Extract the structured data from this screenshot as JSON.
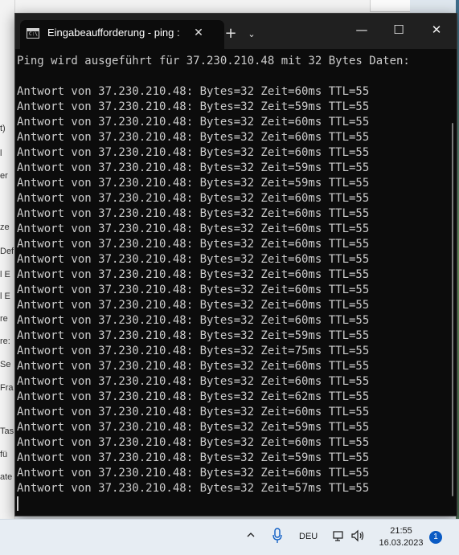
{
  "background_window": {
    "labels": [
      "t)",
      "l",
      "er",
      "ze",
      "Def",
      "l E",
      "l E",
      "re",
      "re:",
      "Se",
      "Fra",
      "Tas",
      "fü",
      "ate"
    ]
  },
  "terminal": {
    "tab_title": "Eingabeaufforderung - ping :",
    "tab_icon_glyph": "C:\\",
    "new_tab_label": "+",
    "dropdown_label": "⌄",
    "minimize_label": "—",
    "maximize_label": "☐",
    "close_label": "✕",
    "tab_close_label": "✕",
    "lines": [
      "Ping wird ausgeführt für 37.230.210.48 mit 32 Bytes Daten:",
      "",
      "Antwort von 37.230.210.48: Bytes=32 Zeit=60ms TTL=55",
      "Antwort von 37.230.210.48: Bytes=32 Zeit=59ms TTL=55",
      "Antwort von 37.230.210.48: Bytes=32 Zeit=60ms TTL=55",
      "Antwort von 37.230.210.48: Bytes=32 Zeit=60ms TTL=55",
      "Antwort von 37.230.210.48: Bytes=32 Zeit=60ms TTL=55",
      "Antwort von 37.230.210.48: Bytes=32 Zeit=59ms TTL=55",
      "Antwort von 37.230.210.48: Bytes=32 Zeit=59ms TTL=55",
      "Antwort von 37.230.210.48: Bytes=32 Zeit=60ms TTL=55",
      "Antwort von 37.230.210.48: Bytes=32 Zeit=60ms TTL=55",
      "Antwort von 37.230.210.48: Bytes=32 Zeit=60ms TTL=55",
      "Antwort von 37.230.210.48: Bytes=32 Zeit=60ms TTL=55",
      "Antwort von 37.230.210.48: Bytes=32 Zeit=60ms TTL=55",
      "Antwort von 37.230.210.48: Bytes=32 Zeit=60ms TTL=55",
      "Antwort von 37.230.210.48: Bytes=32 Zeit=60ms TTL=55",
      "Antwort von 37.230.210.48: Bytes=32 Zeit=60ms TTL=55",
      "Antwort von 37.230.210.48: Bytes=32 Zeit=60ms TTL=55",
      "Antwort von 37.230.210.48: Bytes=32 Zeit=59ms TTL=55",
      "Antwort von 37.230.210.48: Bytes=32 Zeit=75ms TTL=55",
      "Antwort von 37.230.210.48: Bytes=32 Zeit=60ms TTL=55",
      "Antwort von 37.230.210.48: Bytes=32 Zeit=60ms TTL=55",
      "Antwort von 37.230.210.48: Bytes=32 Zeit=62ms TTL=55",
      "Antwort von 37.230.210.48: Bytes=32 Zeit=60ms TTL=55",
      "Antwort von 37.230.210.48: Bytes=32 Zeit=59ms TTL=55",
      "Antwort von 37.230.210.48: Bytes=32 Zeit=60ms TTL=55",
      "Antwort von 37.230.210.48: Bytes=32 Zeit=59ms TTL=55",
      "Antwort von 37.230.210.48: Bytes=32 Zeit=60ms TTL=55",
      "Antwort von 37.230.210.48: Bytes=32 Zeit=57ms TTL=55"
    ]
  },
  "taskbar": {
    "chevron": "^",
    "language": "DEU",
    "time": "21:55",
    "date": "16.03.2023",
    "notification_count": "1",
    "icons": [
      "chevron-up-icon",
      "microphone-icon",
      "network-icon",
      "volume-icon"
    ]
  },
  "colors": {
    "terminal_bg": "#0c0c0c",
    "terminal_text": "#cccccc",
    "titlebar_bg": "#202020",
    "accent": "#0a5bc4"
  }
}
